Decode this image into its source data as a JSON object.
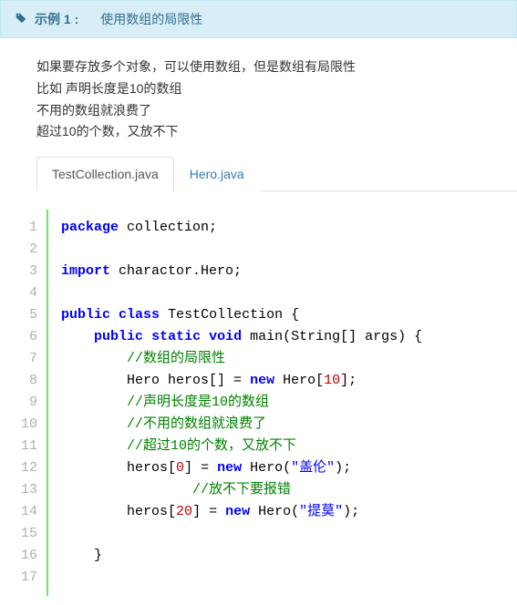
{
  "banner": {
    "label": "示例 1 :",
    "title": "使用数组的局限性"
  },
  "description": {
    "lines": [
      "如果要存放多个对象，可以使用数组，但是数组有局限性",
      "比如 声明长度是10的数组",
      "不用的数组就浪费了",
      "超过10的个数，又放不下"
    ]
  },
  "tabs": [
    {
      "label": "TestCollection.java",
      "active": true
    },
    {
      "label": "Hero.java",
      "active": false
    }
  ],
  "code": {
    "lines": [
      {
        "n": 1,
        "tokens": [
          {
            "c": "kw",
            "t": "package"
          },
          {
            "c": "pln",
            "t": " collection;"
          }
        ]
      },
      {
        "n": 2,
        "tokens": []
      },
      {
        "n": 3,
        "tokens": [
          {
            "c": "kw",
            "t": "import"
          },
          {
            "c": "pln",
            "t": " charactor.Hero;"
          }
        ]
      },
      {
        "n": 4,
        "tokens": []
      },
      {
        "n": 5,
        "tokens": [
          {
            "c": "kw",
            "t": "public"
          },
          {
            "c": "pln",
            "t": " "
          },
          {
            "c": "kw",
            "t": "class"
          },
          {
            "c": "pln",
            "t": " TestCollection {"
          }
        ]
      },
      {
        "n": 6,
        "tokens": [
          {
            "c": "pln",
            "t": "    "
          },
          {
            "c": "kw",
            "t": "public"
          },
          {
            "c": "pln",
            "t": " "
          },
          {
            "c": "kw",
            "t": "static"
          },
          {
            "c": "pln",
            "t": " "
          },
          {
            "c": "kw",
            "t": "void"
          },
          {
            "c": "pln",
            "t": " main(String[] args) {"
          }
        ]
      },
      {
        "n": 7,
        "tokens": [
          {
            "c": "pln",
            "t": "        "
          },
          {
            "c": "com",
            "t": "//数组的局限性"
          }
        ]
      },
      {
        "n": 8,
        "tokens": [
          {
            "c": "pln",
            "t": "        Hero heros[] = "
          },
          {
            "c": "kw",
            "t": "new"
          },
          {
            "c": "pln",
            "t": " Hero["
          },
          {
            "c": "num",
            "t": "10"
          },
          {
            "c": "pln",
            "t": "];"
          }
        ]
      },
      {
        "n": 9,
        "tokens": [
          {
            "c": "pln",
            "t": "        "
          },
          {
            "c": "com",
            "t": "//声明长度是10的数组"
          }
        ]
      },
      {
        "n": 10,
        "tokens": [
          {
            "c": "pln",
            "t": "        "
          },
          {
            "c": "com",
            "t": "//不用的数组就浪费了"
          }
        ]
      },
      {
        "n": 11,
        "tokens": [
          {
            "c": "pln",
            "t": "        "
          },
          {
            "c": "com",
            "t": "//超过10的个数，又放不下"
          }
        ]
      },
      {
        "n": 12,
        "tokens": [
          {
            "c": "pln",
            "t": "        heros["
          },
          {
            "c": "num",
            "t": "0"
          },
          {
            "c": "pln",
            "t": "] = "
          },
          {
            "c": "kw",
            "t": "new"
          },
          {
            "c": "pln",
            "t": " Hero("
          },
          {
            "c": "str",
            "t": "\"盖伦\""
          },
          {
            "c": "pln",
            "t": ");"
          }
        ]
      },
      {
        "n": 13,
        "tokens": [
          {
            "c": "pln",
            "t": "                "
          },
          {
            "c": "com",
            "t": "//放不下要报错"
          }
        ]
      },
      {
        "n": 14,
        "tokens": [
          {
            "c": "pln",
            "t": "        heros["
          },
          {
            "c": "num",
            "t": "20"
          },
          {
            "c": "pln",
            "t": "] = "
          },
          {
            "c": "kw",
            "t": "new"
          },
          {
            "c": "pln",
            "t": " Hero("
          },
          {
            "c": "str",
            "t": "\"提莫\""
          },
          {
            "c": "pln",
            "t": ");"
          }
        ]
      },
      {
        "n": 15,
        "tokens": []
      },
      {
        "n": 16,
        "tokens": [
          {
            "c": "pln",
            "t": "    }"
          }
        ]
      },
      {
        "n": 17,
        "tokens": []
      }
    ]
  }
}
